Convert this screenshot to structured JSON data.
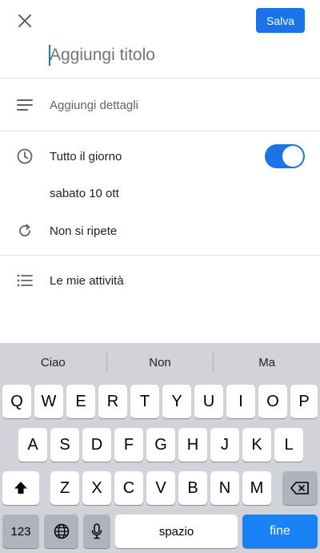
{
  "header": {
    "save_label": "Salva",
    "title_placeholder": "Aggiungi titolo"
  },
  "details": {
    "label": "Aggiungi dettagli"
  },
  "all_day": {
    "label": "Tutto il giorno",
    "enabled": true
  },
  "date": {
    "label": "sabato 10 ott"
  },
  "repeat": {
    "label": "Non si ripete"
  },
  "tasks": {
    "label": "Le mie attività"
  },
  "keyboard": {
    "suggestions": [
      "Ciao",
      "Non",
      "Ma"
    ],
    "row1": [
      "Q",
      "W",
      "E",
      "R",
      "T",
      "Y",
      "U",
      "I",
      "O",
      "P"
    ],
    "row2": [
      "A",
      "S",
      "D",
      "F",
      "G",
      "H",
      "J",
      "K",
      "L"
    ],
    "row3": [
      "Z",
      "X",
      "C",
      "V",
      "B",
      "N",
      "M"
    ],
    "numbers_label": "123",
    "space_label": "spazio",
    "return_label": "fine"
  },
  "colors": {
    "accent": "#1a73e8",
    "return_key": "#1a82f7"
  }
}
